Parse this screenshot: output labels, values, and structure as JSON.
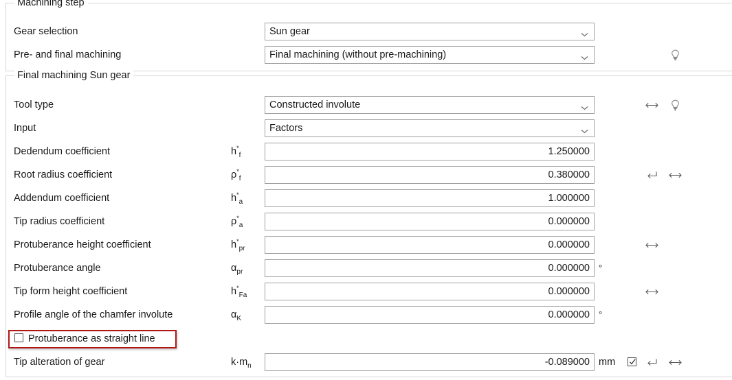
{
  "groups": {
    "machining_step": {
      "title": "Machining step",
      "rows": [
        {
          "label": "Gear selection",
          "control": "combo",
          "value": "Sun gear",
          "icons": []
        },
        {
          "label": "Pre- and final machining",
          "control": "combo",
          "value": "Final machining (without pre-machining)",
          "icons": [
            "lightbulb-icon"
          ]
        }
      ]
    },
    "final_machining": {
      "title": "Final machining Sun gear",
      "rows": [
        {
          "label": "Tool type",
          "control": "combo",
          "value": "Constructed involute",
          "icons": [
            "resize-horizontal-icon",
            "lightbulb-icon"
          ]
        },
        {
          "label": "Input",
          "control": "combo",
          "value": "Factors",
          "icons": []
        },
        {
          "label": "Dedendum coefficient",
          "symbol_base": "h",
          "symbol_sup": "*",
          "symbol_sub": "f",
          "control": "field",
          "value": "1.250000",
          "unit": "",
          "icons": []
        },
        {
          "label": "Root radius coefficient",
          "symbol_base": "ρ",
          "symbol_sup": "*",
          "symbol_sub": "f",
          "control": "field",
          "value": "0.380000",
          "unit": "",
          "icons": [
            "return-arrow-icon",
            "resize-horizontal-icon"
          ]
        },
        {
          "label": "Addendum coefficient",
          "symbol_base": "h",
          "symbol_sup": "*",
          "symbol_sub": "a",
          "control": "field",
          "value": "1.000000",
          "unit": "",
          "icons": []
        },
        {
          "label": "Tip radius coefficient",
          "symbol_base": "ρ",
          "symbol_sup": "*",
          "symbol_sub": "a",
          "control": "field",
          "value": "0.000000",
          "unit": "",
          "icons": []
        },
        {
          "label": "Protuberance height coefficient",
          "symbol_base": "h",
          "symbol_sup": "*",
          "symbol_sub": "pr",
          "control": "field",
          "value": "0.000000",
          "unit": "",
          "icons": [
            "resize-horizontal-icon"
          ]
        },
        {
          "label": "Protuberance angle",
          "symbol_base": "α",
          "symbol_sup": "",
          "symbol_sub": "pr",
          "control": "field",
          "value": "0.000000",
          "unit": "°",
          "icons": []
        },
        {
          "label": "Tip form height coefficient",
          "symbol_base": "h",
          "symbol_sup": "*",
          "symbol_sub": "Fa",
          "control": "field",
          "value": "0.000000",
          "unit": "",
          "icons": [
            "resize-horizontal-icon"
          ]
        },
        {
          "label": "Profile angle of the chamfer involute",
          "symbol_base": "α",
          "symbol_sup": "",
          "symbol_sub": "K",
          "control": "field",
          "value": "0.000000",
          "unit": "°",
          "icons": []
        },
        {
          "label": "Protuberance as straight line",
          "control": "checkbox",
          "checked": false,
          "icons": []
        },
        {
          "label": "Tip alteration of gear",
          "symbol_base": "k·m",
          "symbol_sup": "",
          "symbol_sub": "n",
          "control": "field",
          "value": "-0.089000",
          "unit": "mm",
          "mini_checkbox_checked": true,
          "icons": [
            "return-arrow-icon",
            "resize-horizontal-icon"
          ]
        }
      ]
    }
  },
  "annotation": {
    "target": "Protuberance as straight line",
    "color": "#b01818"
  },
  "colors": {
    "group_border": "#d6d6d6",
    "control_border": "#a0a0a0",
    "icon": "#6b6b6b",
    "text": "#1a1a1a",
    "annotation": "#b01818"
  }
}
